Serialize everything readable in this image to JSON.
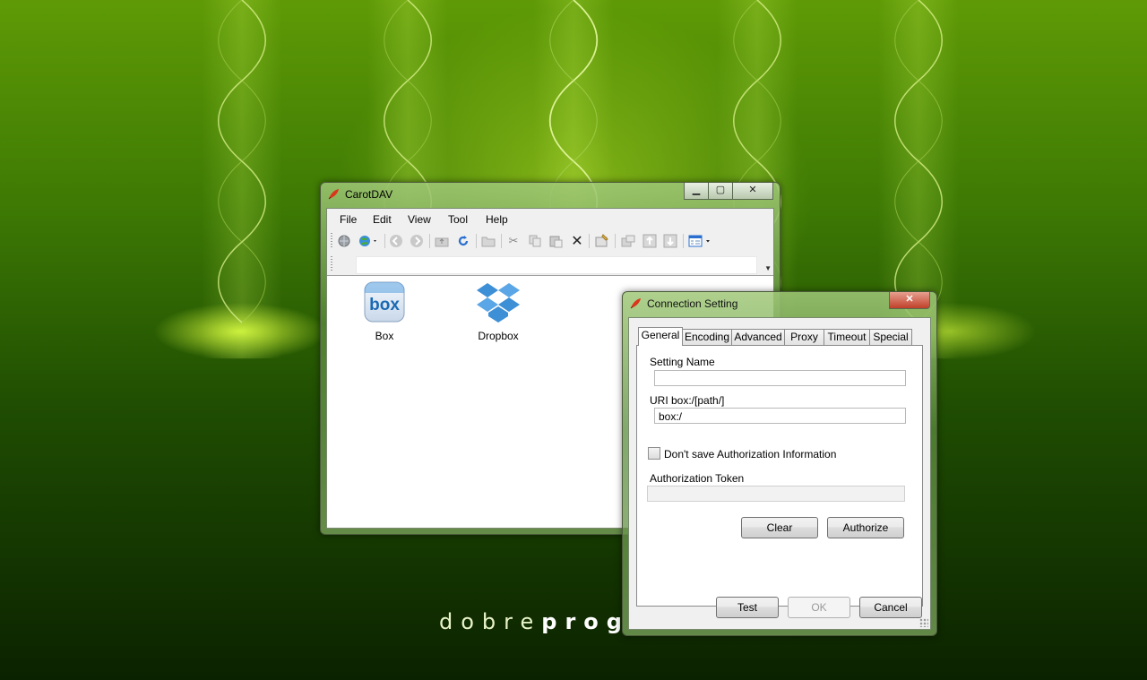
{
  "desktop": {
    "brand_light": "dobre",
    "brand_bold": "prog"
  },
  "main_window": {
    "title": "CarotDAV",
    "caption": {
      "minimize": "▁",
      "maximize": "▢",
      "close": "✕"
    },
    "menu": [
      "File",
      "Edit",
      "View",
      "Tool",
      "Help"
    ],
    "toolbar_icons": [
      "connect-icon",
      "globe-icon",
      "back-icon",
      "forward-icon",
      "up-folder-icon",
      "refresh-icon",
      "new-folder-icon",
      "cut-icon",
      "copy-icon",
      "paste-icon",
      "delete-icon",
      "properties-icon",
      "move-icon",
      "upload-icon",
      "download-icon",
      "view-icon"
    ],
    "files": [
      {
        "label": "Box",
        "icon": "box-icon",
        "icon_text": "box"
      },
      {
        "label": "Dropbox",
        "icon": "dropbox-icon"
      }
    ]
  },
  "dialog": {
    "title": "Connection Setting",
    "close": "✕",
    "tabs": [
      "General",
      "Encoding",
      "Advanced",
      "Proxy",
      "Timeout",
      "Special"
    ],
    "active_tab": "General",
    "setting_name_label": "Setting Name",
    "setting_name_value": "",
    "uri_label": "URI  box:/[path/]",
    "uri_value": "box:/",
    "dont_save_label": "Don't save Authorization Information",
    "dont_save_checked": false,
    "auth_token_label": "Authorization Token",
    "auth_token_value": "",
    "clear_button": "Clear",
    "authorize_button": "Authorize",
    "test_button": "Test",
    "ok_button": "OK",
    "cancel_button": "Cancel"
  },
  "colors": {
    "accent_green": "#5f9a06",
    "box_blue": "#1a6ab3",
    "dropbox_blue": "#3d8fd6",
    "carrot_red": "#d9361c"
  }
}
